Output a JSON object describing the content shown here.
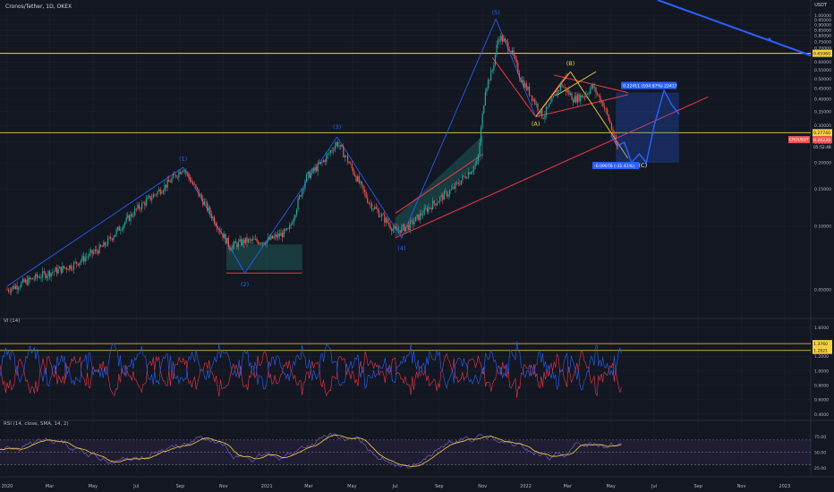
{
  "header": {
    "symbol_title": "Cronos/Tether, 1D, OKEX",
    "currency": "USDT"
  },
  "price_panel": {
    "ticks": [
      "1.00000",
      "0.95000",
      "0.90000",
      "0.85000",
      "0.80000",
      "0.75000",
      "0.70000",
      "0.65000",
      "0.60000",
      "0.55000",
      "0.50000",
      "0.45000",
      "0.40000",
      "0.35000",
      "0.30000",
      "0.25000",
      "0.20000",
      "0.15000",
      "0.10000",
      "0.05000"
    ],
    "tick_values": [
      1.0,
      0.95,
      0.9,
      0.85,
      0.8,
      0.75,
      0.7,
      0.65,
      0.6,
      0.55,
      0.5,
      0.45,
      0.4,
      0.35,
      0.3,
      0.25,
      0.2,
      0.15,
      0.1,
      0.05
    ],
    "resistance_label": "0.65960",
    "support_label": "0.27740",
    "last_price_label": "0.26230",
    "symbol_badge": "CROUSDT",
    "countdown_label": "05:52:48",
    "levels": {
      "resistance": 0.6596,
      "support": 0.2774,
      "last": 0.2623
    },
    "colors": {
      "up": "#26a69a",
      "down": "#ef5350",
      "wave": "#2962ff",
      "level": "#f7d23e",
      "trend": "#f23645",
      "bg": "#131722",
      "grid": "#1e222d"
    }
  },
  "waves": {
    "impulse_labels": [
      "(1)",
      "(2)",
      "(3)",
      "(4)",
      "(5)"
    ],
    "correction_labels": [
      "(A)",
      "(B)",
      "(C)"
    ]
  },
  "projection": {
    "up_label": "0.22411 (104.87%) 22417",
    "down_label": "-0.09076 (-31.41%)"
  },
  "vi_panel": {
    "title": "VI (14)",
    "ticks": [
      "1.6000",
      "1.4000",
      "1.2000",
      "1.0000",
      "0.8000",
      "0.6000",
      "0.4000"
    ],
    "tick_values": [
      1.6,
      1.4,
      1.2,
      1.0,
      0.8,
      0.6,
      0.4
    ],
    "upper_label": "1.3760",
    "lower_label": "1.2821",
    "levels": {
      "upper": 1.376,
      "lower": 1.2821
    },
    "colors": {
      "plus": "#2962ff",
      "minus": "#f23645"
    }
  },
  "rsi_panel": {
    "title": "RSI (14, close, SMA, 14, 2)",
    "ticks": [
      "75.00",
      "50.00",
      "25.00"
    ],
    "tick_values": [
      75,
      50,
      25
    ],
    "band": [
      30,
      70
    ],
    "colors": {
      "rsi": "#7e57c2",
      "ma": "#f7d23e"
    }
  },
  "time_axis": {
    "labels": [
      "2020",
      "Mar",
      "May",
      "Jul",
      "Sep",
      "Nov",
      "2021",
      "Mar",
      "May",
      "Jul",
      "Sep",
      "Nov",
      "2022",
      "Mar",
      "May",
      "Jul",
      "Sep",
      "Nov",
      "2023"
    ]
  },
  "chart_data": {
    "type": "line",
    "title": "Cronos/Tether, 1D, OKEX",
    "xlabel": "",
    "ylabel": "",
    "y_scale": "log",
    "ylim": [
      0.038,
      1.05
    ],
    "x_range": [
      "2020-01-01",
      "2023-01-15"
    ],
    "grid": true,
    "series": [
      {
        "x": [
          "2020-01-01",
          "2020-02-15",
          "2020-04-01",
          "2020-05-15",
          "2020-07-01",
          "2020-08-15",
          "2020-09-05",
          "2020-10-10",
          "2020-11-10",
          "2020-12-01",
          "2020-12-31",
          "2021-02-01",
          "2021-02-25",
          "2021-03-20",
          "2021-04-10",
          "2021-04-25",
          "2021-05-25",
          "2021-07-01",
          "2021-07-20",
          "2021-08-20",
          "2021-09-20",
          "2021-10-25",
          "2021-11-05",
          "2021-11-15",
          "2021-11-24",
          "2021-12-10",
          "2021-12-25",
          "2022-01-10",
          "2022-01-25",
          "2022-02-05",
          "2022-02-20",
          "2022-03-10",
          "2022-03-25",
          "2022-04-05",
          "2022-04-20",
          "2022-05-01",
          "2022-05-10"
        ],
        "values": [
          0.05,
          0.058,
          0.065,
          0.08,
          0.12,
          0.16,
          0.19,
          0.12,
          0.08,
          0.085,
          0.085,
          0.095,
          0.17,
          0.2,
          0.25,
          0.205,
          0.13,
          0.095,
          0.1,
          0.125,
          0.15,
          0.2,
          0.45,
          0.55,
          0.8,
          0.7,
          0.5,
          0.41,
          0.33,
          0.38,
          0.47,
          0.4,
          0.42,
          0.46,
          0.38,
          0.3,
          0.23
        ]
      }
    ]
  }
}
